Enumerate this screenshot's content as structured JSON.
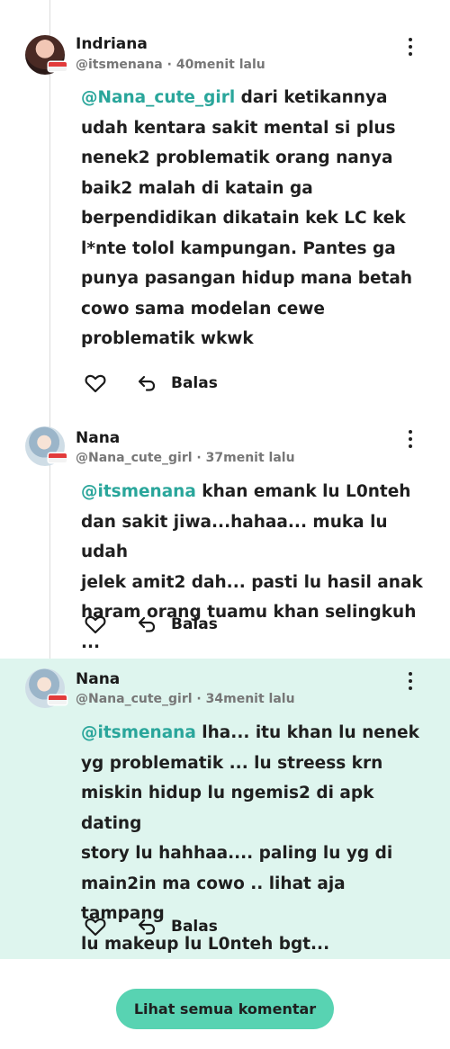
{
  "comments": [
    {
      "name": "Indriana",
      "handle": "@itsmenana",
      "time": "40menit lalu",
      "mention": "@Nana_cute_girl",
      "lines": [
        "dari ketikannya",
        "udah kentara sakit mental si plus",
        "nenek2 problematik orang nanya",
        "baik2 malah di katain ga",
        "berpendidikan dikatain kek LC kek",
        "l*nte tolol kampungan. Pantes ga",
        "punya pasangan hidup mana betah",
        "cowo sama modelan cewe",
        "problematik wkwk"
      ],
      "reply_label": "Balas"
    },
    {
      "name": "Nana",
      "handle": "@Nana_cute_girl",
      "time": "37menit lalu",
      "mention": "@itsmenana",
      "lines": [
        "khan emank lu L0nteh",
        "dan sakit jiwa...hahaa... muka lu udah",
        "jelek amit2 dah... pasti lu hasil anak",
        "haram orang tuamu khan selingkuh ..."
      ],
      "reply_label": "Balas"
    },
    {
      "name": "Nana",
      "handle": "@Nana_cute_girl",
      "time": "34menit lalu",
      "mention": "@itsmenana",
      "lines": [
        "lha... itu khan lu nenek",
        "yg problematik ...  lu streess krn",
        "miskin hidup lu ngemis2 di apk dating",
        "story lu hahhaa.... paling lu yg di",
        "main2in ma cowo .. lihat aja tampang",
        "lu  makeup lu L0nteh bgt..."
      ],
      "reply_label": "Balas"
    }
  ],
  "view_all_label": "Lihat semua komentar",
  "colors": {
    "accent": "#58d3b2",
    "mention": "#2aa69b",
    "highlight": "#def5ee"
  }
}
